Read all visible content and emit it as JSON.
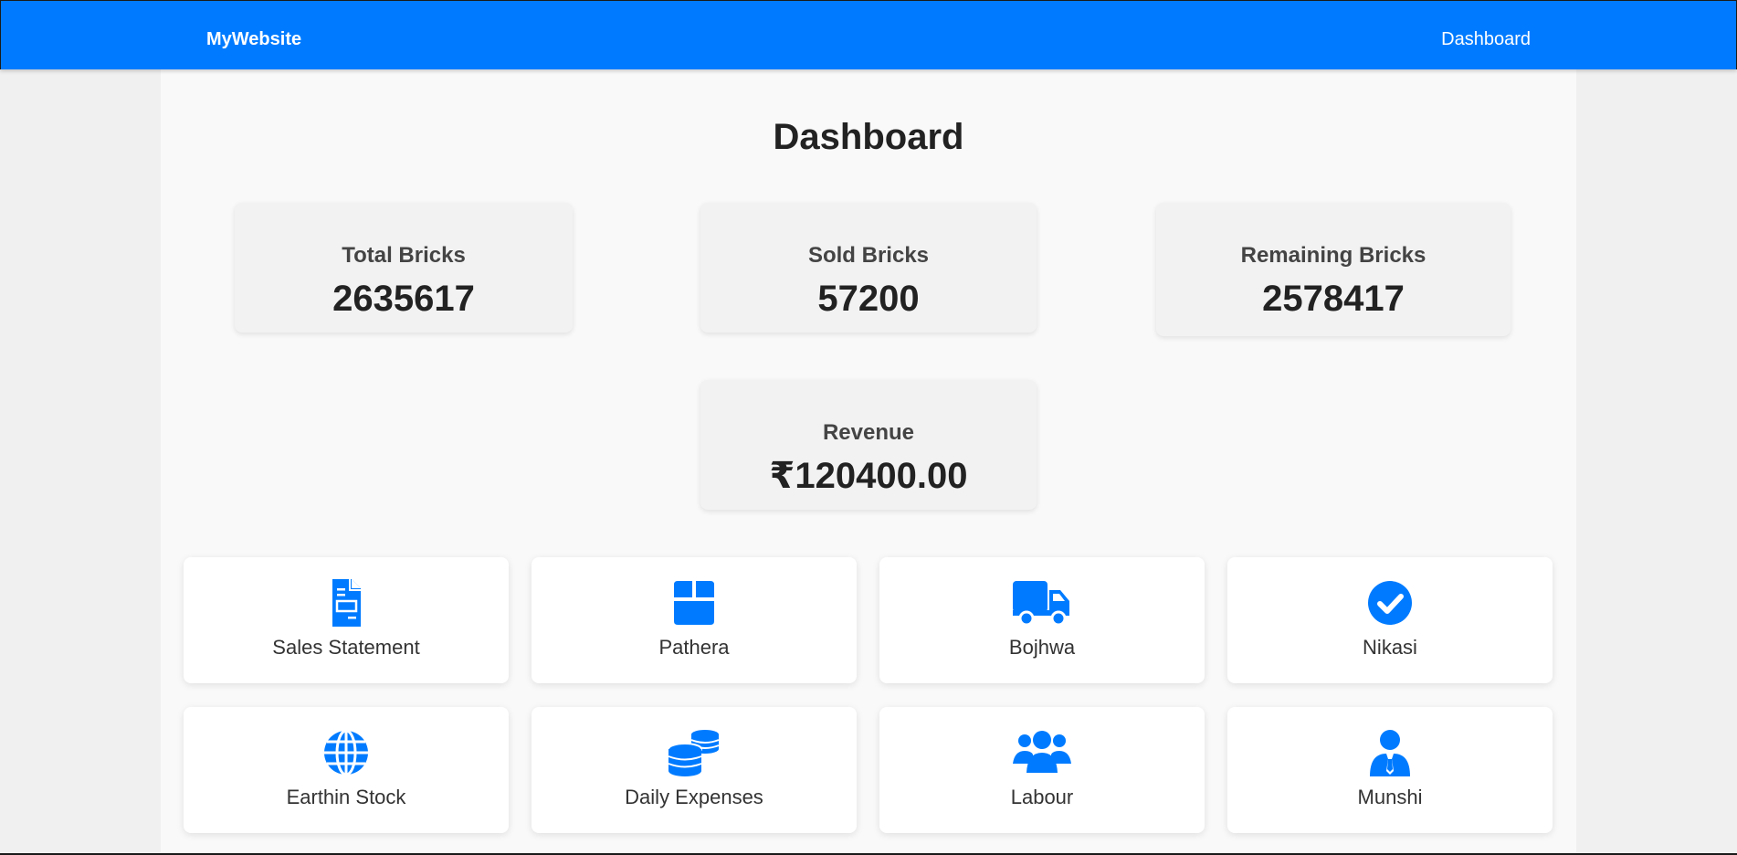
{
  "navbar": {
    "brand": "MyWebsite",
    "link": "Dashboard",
    "color": "#007bff"
  },
  "page": {
    "title": "Dashboard"
  },
  "stats": [
    {
      "label": "Total Bricks",
      "value": "2635617"
    },
    {
      "label": "Sold Bricks",
      "value": "57200"
    },
    {
      "label": "Remaining Bricks",
      "value": "2578417"
    },
    {
      "label": "Revenue",
      "value": "₹120400.00"
    }
  ],
  "tiles": [
    {
      "label": "Sales Statement",
      "icon": "file-invoice-icon"
    },
    {
      "label": "Pathera",
      "icon": "box-icon"
    },
    {
      "label": "Bojhwa",
      "icon": "truck-icon"
    },
    {
      "label": "Nikasi",
      "icon": "check-circle-icon"
    },
    {
      "label": "Earthin Stock",
      "icon": "globe-icon"
    },
    {
      "label": "Daily Expenses",
      "icon": "coins-icon"
    },
    {
      "label": "Labour",
      "icon": "users-icon"
    },
    {
      "label": "Munshi",
      "icon": "user-tie-icon"
    }
  ],
  "colors": {
    "accent": "#007bff",
    "card_bg": "#f2f2f2",
    "tile_bg": "#ffffff"
  }
}
